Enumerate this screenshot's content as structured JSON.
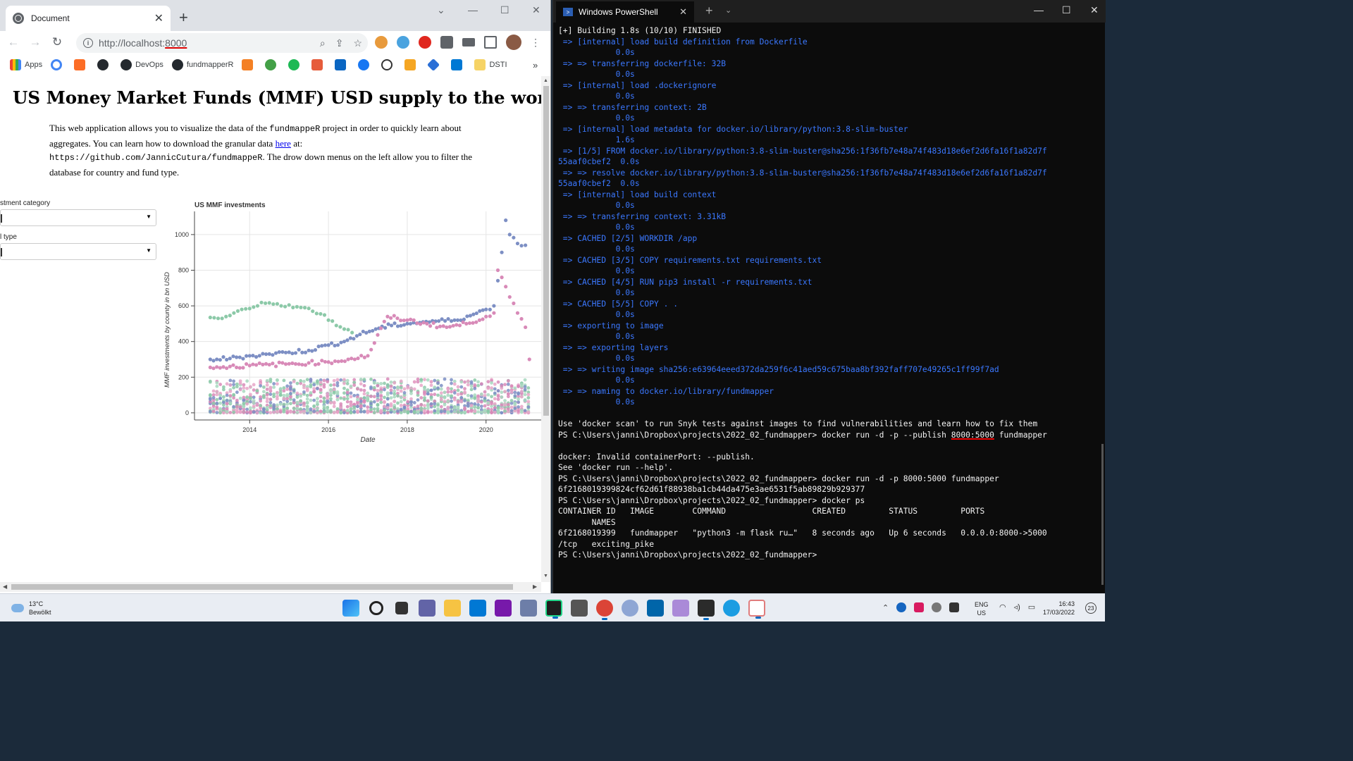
{
  "chrome": {
    "tab_title": "Document",
    "url_host": "http://localhost:",
    "url_port": "8000",
    "bookmarks": [
      "Apps",
      "DevOps",
      "fundmapperR",
      "DSTI"
    ],
    "more_bookmarks": "»"
  },
  "page": {
    "title": "US Money Market Funds (MMF) USD supply to the world",
    "intro_1": "This web application allows you to visualize the data of the ",
    "intro_code_1": "fundmappeR",
    "intro_2": " project in order to quickly learn about aggregates. You can learn how to download the granular data ",
    "intro_link": "here",
    "intro_3": " at: ",
    "intro_code_2": "https://github.com/JannicCutura/fundmappeR",
    "intro_4": ". The drow down menus on the left allow you to filter the database for country and fund type.",
    "dropdown1_label": "stment category",
    "dropdown2_label": "l type"
  },
  "chart_data": {
    "type": "scatter",
    "title": "US MMF investments",
    "xlabel": "Date",
    "ylabel": "MMF investments by county in bn USD",
    "x_ticks": [
      "2014",
      "2016",
      "2018",
      "2020"
    ],
    "y_ticks": [
      "0",
      "200",
      "400",
      "600",
      "800",
      "1000"
    ],
    "xlim": [
      2012.6,
      2021.4
    ],
    "ylim": [
      -40,
      1130
    ],
    "grid": true,
    "colors": {
      "green": "#8cc9a8",
      "blue": "#7d8fc4",
      "pink": "#d88ab8"
    },
    "series": [
      {
        "color": "green",
        "points": [
          [
            2013.0,
            535
          ],
          [
            2013.2,
            530
          ],
          [
            2013.4,
            540
          ],
          [
            2013.6,
            560
          ],
          [
            2013.8,
            580
          ],
          [
            2014.0,
            585
          ],
          [
            2014.2,
            600
          ],
          [
            2014.4,
            615
          ],
          [
            2014.6,
            610
          ],
          [
            2014.8,
            600
          ],
          [
            2015.0,
            605
          ],
          [
            2015.2,
            595
          ],
          [
            2015.4,
            590
          ],
          [
            2015.6,
            570
          ],
          [
            2015.8,
            555
          ],
          [
            2016.0,
            520
          ],
          [
            2016.2,
            490
          ],
          [
            2016.4,
            470
          ],
          [
            2016.6,
            450
          ]
        ]
      },
      {
        "color": "blue",
        "points": [
          [
            2013.0,
            300
          ],
          [
            2013.5,
            305
          ],
          [
            2014.0,
            320
          ],
          [
            2014.5,
            330
          ],
          [
            2015.0,
            340
          ],
          [
            2015.5,
            350
          ],
          [
            2016.0,
            380
          ],
          [
            2016.4,
            400
          ],
          [
            2016.8,
            440
          ],
          [
            2017.2,
            470
          ],
          [
            2017.6,
            490
          ],
          [
            2018.0,
            500
          ],
          [
            2018.4,
            510
          ],
          [
            2018.8,
            515
          ],
          [
            2019.2,
            520
          ],
          [
            2019.6,
            545
          ],
          [
            2020.0,
            580
          ],
          [
            2020.2,
            600
          ],
          [
            2020.4,
            900
          ],
          [
            2020.5,
            1080
          ],
          [
            2020.6,
            1000
          ],
          [
            2020.8,
            950
          ],
          [
            2021.0,
            940
          ]
        ]
      },
      {
        "color": "pink",
        "points": [
          [
            2013.0,
            255
          ],
          [
            2013.5,
            260
          ],
          [
            2014.0,
            265
          ],
          [
            2014.5,
            270
          ],
          [
            2015.0,
            275
          ],
          [
            2015.5,
            280
          ],
          [
            2016.0,
            285
          ],
          [
            2016.5,
            300
          ],
          [
            2017.0,
            320
          ],
          [
            2017.5,
            540
          ],
          [
            2018.0,
            520
          ],
          [
            2018.5,
            500
          ],
          [
            2019.0,
            480
          ],
          [
            2019.5,
            500
          ],
          [
            2020.0,
            540
          ],
          [
            2020.2,
            560
          ],
          [
            2020.3,
            800
          ],
          [
            2020.4,
            760
          ],
          [
            2020.6,
            650
          ],
          [
            2020.8,
            560
          ],
          [
            2021.0,
            480
          ],
          [
            2021.1,
            300
          ]
        ]
      }
    ]
  },
  "powershell": {
    "tab_title": "Windows PowerShell",
    "lines": [
      {
        "c": "w",
        "t": "[+] Building 1.8s (10/10) FINISHED"
      },
      {
        "c": "b",
        "t": " => [internal] load build definition from Dockerfile"
      },
      {
        "c": "b",
        "t": "            0.0s"
      },
      {
        "c": "b",
        "t": " => => transferring dockerfile: 32B"
      },
      {
        "c": "b",
        "t": "            0.0s"
      },
      {
        "c": "b",
        "t": " => [internal] load .dockerignore"
      },
      {
        "c": "b",
        "t": "            0.0s"
      },
      {
        "c": "b",
        "t": " => => transferring context: 2B"
      },
      {
        "c": "b",
        "t": "            0.0s"
      },
      {
        "c": "b",
        "t": " => [internal] load metadata for docker.io/library/python:3.8-slim-buster"
      },
      {
        "c": "b",
        "t": "            1.6s"
      },
      {
        "c": "b",
        "t": " => [1/5] FROM docker.io/library/python:3.8-slim-buster@sha256:1f36fb7e48a74f483d18e6ef2d6fa16f1a82d7f"
      },
      {
        "c": "b",
        "t": "55aaf0cbef2  0.0s"
      },
      {
        "c": "b",
        "t": " => => resolve docker.io/library/python:3.8-slim-buster@sha256:1f36fb7e48a74f483d18e6ef2d6fa16f1a82d7f"
      },
      {
        "c": "b",
        "t": "55aaf0cbef2  0.0s"
      },
      {
        "c": "b",
        "t": " => [internal] load build context"
      },
      {
        "c": "b",
        "t": "            0.0s"
      },
      {
        "c": "b",
        "t": " => => transferring context: 3.31kB"
      },
      {
        "c": "b",
        "t": "            0.0s"
      },
      {
        "c": "b",
        "t": " => CACHED [2/5] WORKDIR /app"
      },
      {
        "c": "b",
        "t": "            0.0s"
      },
      {
        "c": "b",
        "t": " => CACHED [3/5] COPY requirements.txt requirements.txt"
      },
      {
        "c": "b",
        "t": "            0.0s"
      },
      {
        "c": "b",
        "t": " => CACHED [4/5] RUN pip3 install -r requirements.txt"
      },
      {
        "c": "b",
        "t": "            0.0s"
      },
      {
        "c": "b",
        "t": " => CACHED [5/5] COPY . ."
      },
      {
        "c": "b",
        "t": "            0.0s"
      },
      {
        "c": "b",
        "t": " => exporting to image"
      },
      {
        "c": "b",
        "t": "            0.0s"
      },
      {
        "c": "b",
        "t": " => => exporting layers"
      },
      {
        "c": "b",
        "t": "            0.0s"
      },
      {
        "c": "b",
        "t": " => => writing image sha256:e63964eeed372da259f6c41aed59c675baa8bf392faff707e49265c1ff99f7ad"
      },
      {
        "c": "b",
        "t": "            0.0s"
      },
      {
        "c": "b",
        "t": " => => naming to docker.io/library/fundmapper"
      },
      {
        "c": "b",
        "t": "            0.0s"
      },
      {
        "c": "w",
        "t": ""
      },
      {
        "c": "w",
        "t": "Use 'docker scan' to run Snyk tests against images to find vulnerabilities and learn how to fix them"
      },
      {
        "c": "w",
        "t": "PS C:\\Users\\janni\\Dropbox\\projects\\2022_02_fundmapper> docker run -d -p --publish ",
        "ul": "8000:5000",
        "t2": " fundmapper"
      },
      {
        "c": "w",
        "t": ""
      },
      {
        "c": "w",
        "t": "docker: Invalid containerPort: --publish."
      },
      {
        "c": "w",
        "t": "See 'docker run --help'."
      },
      {
        "c": "w",
        "t": "PS C:\\Users\\janni\\Dropbox\\projects\\2022_02_fundmapper> docker run -d -p 8000:5000 fundmapper"
      },
      {
        "c": "w",
        "t": "6f2168019399824cf62d61f88938ba1cb44da475e3ae6531f5ab89829b929377"
      },
      {
        "c": "w",
        "t": "PS C:\\Users\\janni\\Dropbox\\projects\\2022_02_fundmapper> docker ps"
      },
      {
        "c": "w",
        "t": "CONTAINER ID   IMAGE        COMMAND                  CREATED         STATUS         PORTS"
      },
      {
        "c": "w",
        "t": "       NAMES"
      },
      {
        "c": "w",
        "t": "6f2168019399   fundmapper   \"python3 -m flask ru…\"   8 seconds ago   Up 6 seconds   0.0.0.0:8000->5000"
      },
      {
        "c": "w",
        "t": "/tcp   exciting_pike"
      },
      {
        "c": "w",
        "t": "PS C:\\Users\\janni\\Dropbox\\projects\\2022_02_fundmapper>"
      }
    ]
  },
  "taskbar": {
    "temperature": "13°C",
    "weather": "Bewölkt",
    "lang_1": "ENG",
    "lang_2": "US",
    "time": "16:43",
    "date": "17/03/2022",
    "notifications": "23"
  }
}
